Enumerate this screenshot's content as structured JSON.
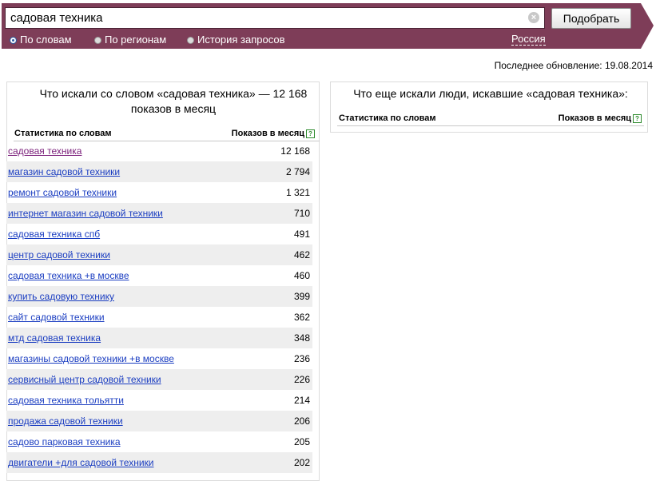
{
  "search": {
    "query": "садовая техника",
    "submit_label": "Подобрать",
    "clear_symbol": "×"
  },
  "radios": [
    {
      "label": "По словам",
      "checked": true
    },
    {
      "label": "По регионам",
      "checked": false
    },
    {
      "label": "История запросов",
      "checked": false
    }
  ],
  "region": "Россия",
  "last_update": "Последнее обновление: 19.08.2014",
  "left_panel": {
    "title": "Что искали со словом «садовая техника» — 12 168 показов в месяц",
    "col_words": "Статистика по словам",
    "col_count": "Показов в месяц",
    "rows": [
      {
        "phrase": "садовая техника",
        "count": "12 168"
      },
      {
        "phrase": "магазин садовой техники",
        "count": "2 794"
      },
      {
        "phrase": "ремонт садовой техники",
        "count": "1 321"
      },
      {
        "phrase": "интернет магазин садовой техники",
        "count": "710"
      },
      {
        "phrase": "садовая техника спб",
        "count": "491"
      },
      {
        "phrase": "центр садовой техники",
        "count": "462"
      },
      {
        "phrase": "садовая техника +в москве",
        "count": "460"
      },
      {
        "phrase": "купить садовую технику",
        "count": "399"
      },
      {
        "phrase": "сайт садовой техники",
        "count": "362"
      },
      {
        "phrase": "мтд садовая техника",
        "count": "348"
      },
      {
        "phrase": "магазины садовой техники +в москве",
        "count": "236"
      },
      {
        "phrase": "сервисный центр садовой техники",
        "count": "226"
      },
      {
        "phrase": "садовая техника тольятти",
        "count": "214"
      },
      {
        "phrase": "продажа садовой техники",
        "count": "206"
      },
      {
        "phrase": "садово парковая техника",
        "count": "205"
      },
      {
        "phrase": "двигатели +для садовой техники",
        "count": "202"
      }
    ]
  },
  "right_panel": {
    "title": "Что еще искали люди, искавшие «садовая техника»:",
    "col_words": "Статистика по словам",
    "col_count": "Показов в месяц"
  },
  "help_symbol": "?",
  "colors": {
    "band": "#7e3d58",
    "link": "#1a3dc1",
    "visited_link": "#7a1e7a",
    "row_alt": "#eeeeee"
  }
}
